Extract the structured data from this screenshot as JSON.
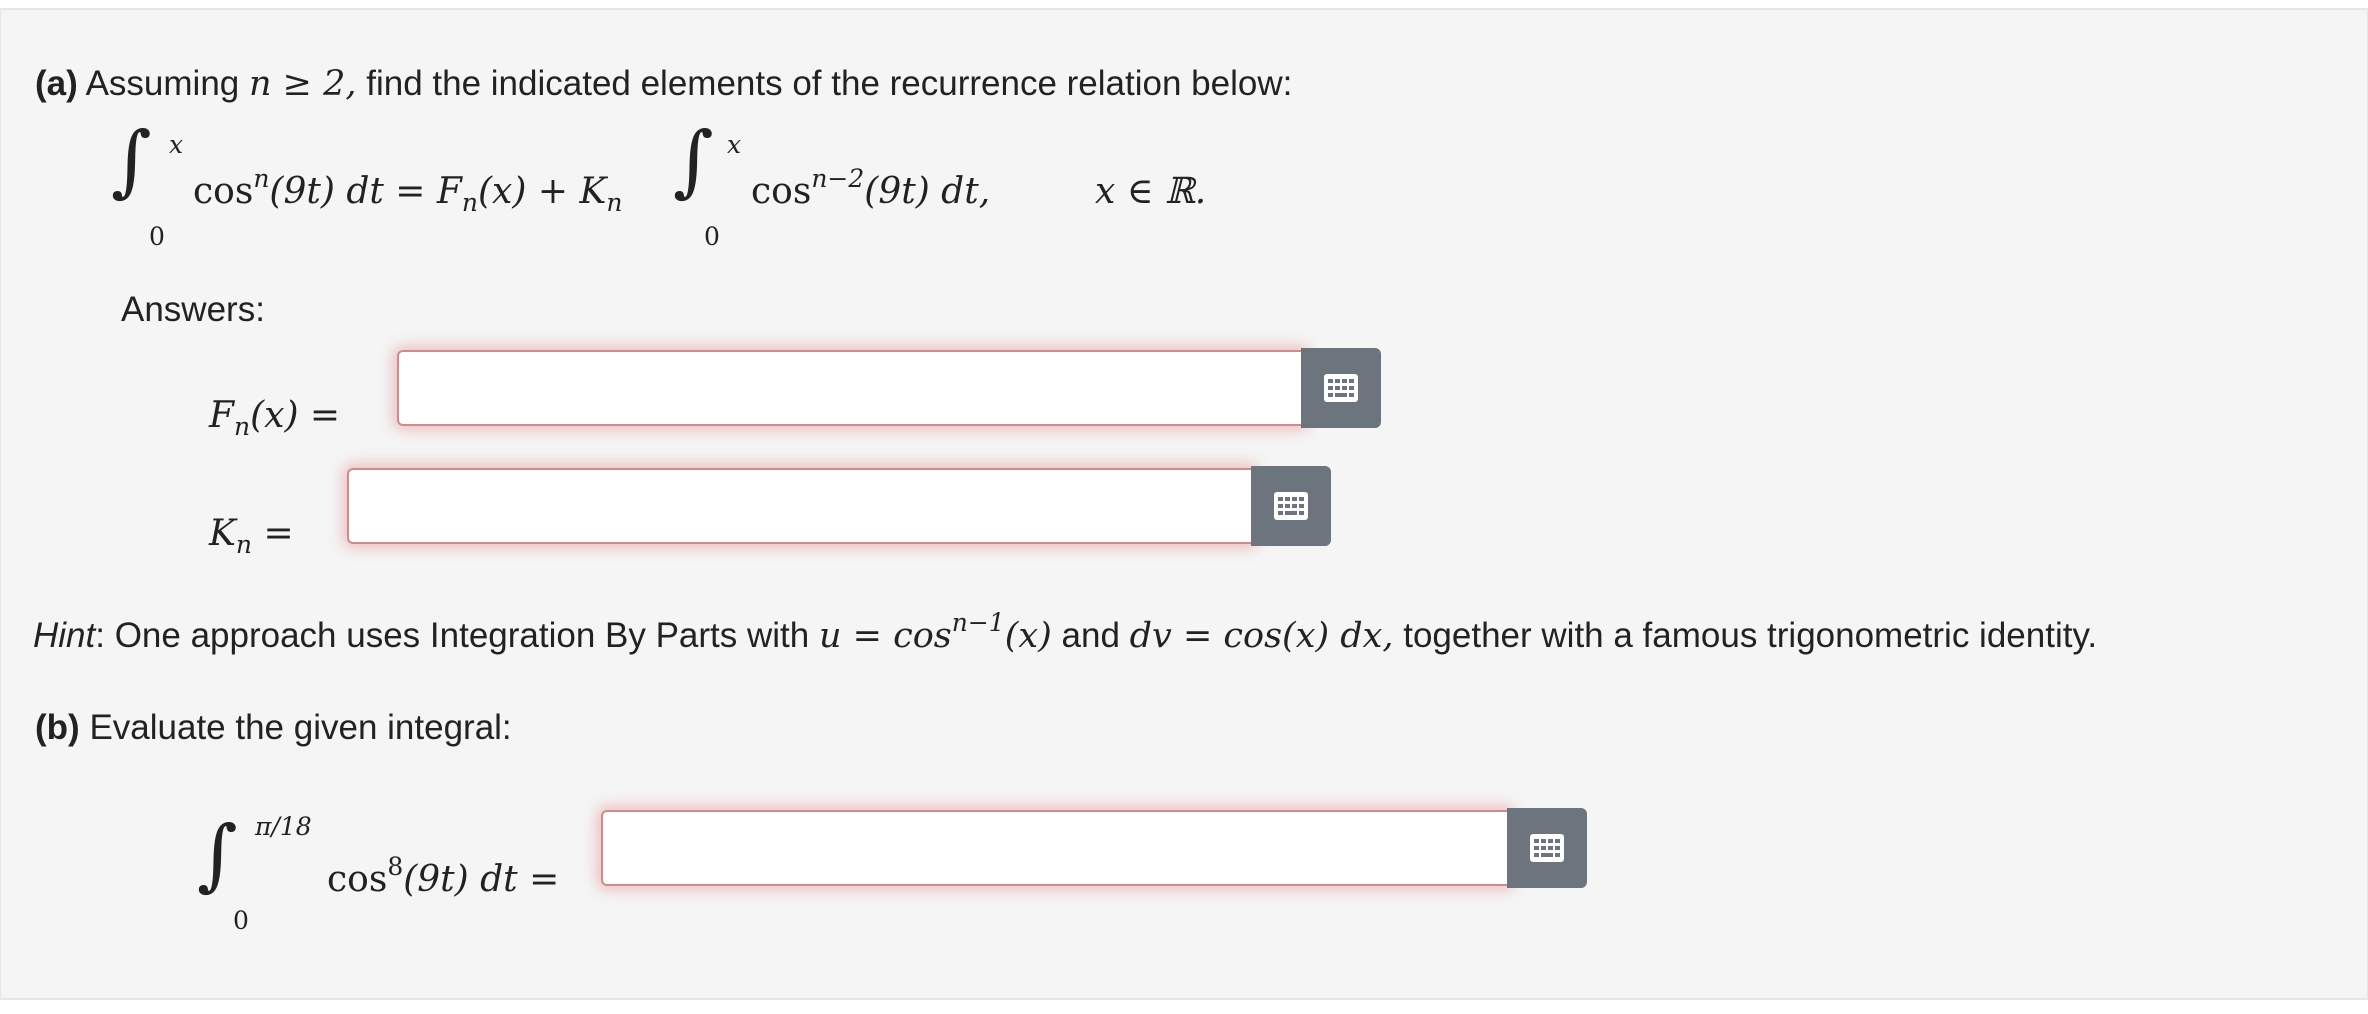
{
  "part_a": {
    "label": "(a)",
    "prompt_prefix": "Assuming",
    "prompt_condition": "n ≥ 2,",
    "prompt_suffix": "find the indicated elements of the recurrence relation below:",
    "equation": {
      "integral1_upper": "x",
      "integral1_lower": "0",
      "integrand1_func": "cos",
      "integrand1_power": "n",
      "integrand1_arg": "(9t) dt",
      "equals_rhs": "= F",
      "F_sub": "n",
      "F_arg": "(x) + K",
      "K_sub": "n",
      "integral2_upper": "x",
      "integral2_lower": "0",
      "integrand2_func": "cos",
      "integrand2_power": "n−2",
      "integrand2_arg": "(9t) dt,",
      "domain": "x ∈ ℝ."
    },
    "answers_label": "Answers:",
    "F_label_main": "F",
    "F_label_sub": "n",
    "F_label_tail": "(x) =",
    "K_label_main": "K",
    "K_label_sub": "n",
    "K_label_tail": "=",
    "F_input_value": "",
    "K_input_value": ""
  },
  "hint": {
    "label": "Hint",
    "text_1": ": One approach uses Integration By Parts with",
    "u_expr": "u = cos",
    "u_power": "n−1",
    "u_arg": "(x)",
    "and": "and",
    "dv_expr": "dv = cos(x) dx,",
    "text_2": "together with a famous trigonometric identity."
  },
  "part_b": {
    "label": "(b)",
    "prompt": "Evaluate the given integral:",
    "upper": "π/18",
    "lower": "0",
    "integrand_func": "cos",
    "integrand_power": "8",
    "integrand_arg": "(9t) dt =",
    "input_value": ""
  },
  "icons": {
    "keyboard_button": "keyboard-grid-icon"
  },
  "colors": {
    "panel_bg": "#f5f5f5",
    "button_bg": "#6c757d",
    "input_border_invalid": "#cf8b8b"
  }
}
